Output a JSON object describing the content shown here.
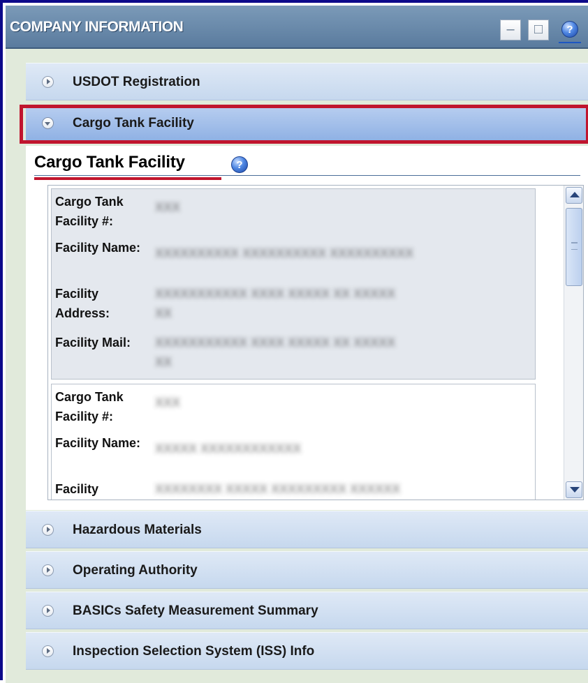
{
  "window": {
    "title": "COMPANY INFORMATION",
    "minimize_glyph": "–",
    "maximize_glyph": "□",
    "help_glyph": "?"
  },
  "icons": {
    "help": "help-icon",
    "expand": "chevron-right-icon",
    "collapse": "chevron-down-icon"
  },
  "accordion": {
    "items": [
      {
        "label": "USDOT Registration",
        "expanded": false
      },
      {
        "label": "Cargo Tank Facility",
        "expanded": true
      },
      {
        "label": "Hazardous Materials",
        "expanded": false
      },
      {
        "label": "Operating Authority",
        "expanded": false
      },
      {
        "label": "BASICs Safety Measurement Summary",
        "expanded": false
      },
      {
        "label": "Inspection Selection System (ISS) Info",
        "expanded": false
      }
    ]
  },
  "section": {
    "title": "Cargo Tank Facility",
    "help_glyph": "?"
  },
  "facilities": [
    {
      "labels": {
        "number": "Cargo Tank Facility #:",
        "name": "Facility Name:",
        "address": "Facility Address:",
        "mail": "Facility Mail:"
      },
      "values": {
        "number": "XXX",
        "name": "XXXXXXXXXX XXXXXXXXXX XXXXXXXXXX",
        "address": "XXXXXXXXXXX XXXX XXXXX XX XXXXX",
        "address2": "XX",
        "mail": "XXXXXXXXXXX XXXX XXXXX XX XXXXX",
        "mail2": "XX"
      }
    },
    {
      "labels": {
        "number": "Cargo Tank Facility #:",
        "name": "Facility Name:",
        "address": "Facility"
      },
      "values": {
        "number": "XXX",
        "name": "XXXXX XXXXXXXXXXXX",
        "address": "XXXXXXXX XXXXX XXXXXXXXX XXXXXX"
      }
    }
  ],
  "colors": {
    "window_border": "#0d0a8a",
    "titlebar": "#6d8cae",
    "highlight": "#c0152e",
    "open_header": "#a3c0ea"
  }
}
